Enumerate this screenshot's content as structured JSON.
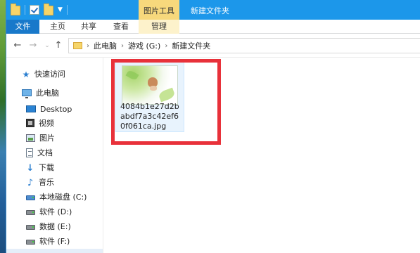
{
  "titlebar": {
    "context_tab": "图片工具",
    "title": "新建文件夹"
  },
  "ribbon": {
    "tabs": [
      "文件",
      "主页",
      "共享",
      "查看",
      "管理"
    ]
  },
  "address": {
    "crumbs": [
      "此电脑",
      "游戏 (G:)",
      "新建文件夹"
    ]
  },
  "nav": {
    "quick_access": "快速访问",
    "this_pc": "此电脑",
    "items": [
      "Desktop",
      "视频",
      "图片",
      "文档",
      "下载",
      "音乐",
      "本地磁盘 (C:)",
      "软件 (D:)",
      "数据 (E:)",
      "软件 (F:)"
    ]
  },
  "file": {
    "name": "4084b1e27d2babdf7a3c42ef60f061ca.jpg"
  },
  "colors": {
    "titlebar": "#1c97ea",
    "file_tab": "#1979ca",
    "context_tab": "#f7d87c",
    "highlight": "#e8313a"
  }
}
